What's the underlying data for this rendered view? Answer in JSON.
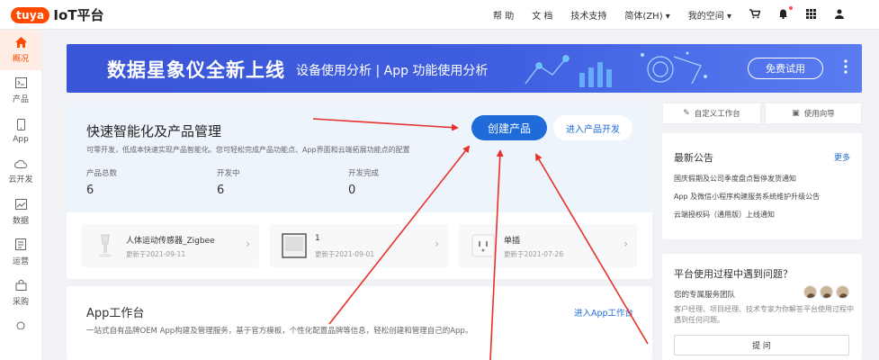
{
  "header": {
    "logo_badge": "tuya",
    "logo_text": "IoT平台",
    "nav": [
      "帮 助",
      "文 档",
      "技术支持",
      "简体(ZH) ▾",
      "我的空间 ▾"
    ],
    "icons": [
      "cart-icon",
      "bell-icon",
      "apps-grid-icon",
      "user-icon"
    ]
  },
  "sidebar": {
    "items": [
      {
        "label": "概况",
        "icon": "home-icon",
        "active": true
      },
      {
        "label": "产品",
        "icon": "terminal-icon"
      },
      {
        "label": "App",
        "icon": "phone-icon"
      },
      {
        "label": "云开发",
        "icon": "cloud-icon"
      },
      {
        "label": "数据",
        "icon": "chart-icon"
      },
      {
        "label": "运营",
        "icon": "operations-icon"
      },
      {
        "label": "采购",
        "icon": "shop-icon"
      }
    ]
  },
  "banner": {
    "title": "数据星象仪全新上线",
    "subtitle": "设备使用分析 | App 功能使用分析",
    "button": "免费试用",
    "more": "⋮"
  },
  "quick": {
    "title": "快速智能化及产品管理",
    "desc": "可零开发，低成本快速实现产品智能化。您可轻松完成产品功能点、App界面和云端拓展功能点的配置",
    "create_button": "创建产品",
    "dev_button": "进入产品开发",
    "stats": [
      {
        "label": "产品总数",
        "value": "6"
      },
      {
        "label": "开发中",
        "value": "6"
      },
      {
        "label": "开发完成",
        "value": "0"
      }
    ],
    "products": [
      {
        "name": "人体运动传感器_Zigbee",
        "date": "更新于2021-09-11"
      },
      {
        "name": "1",
        "date": "更新于2021-09-01"
      },
      {
        "name": "单插",
        "date": "更新于2021-07-26"
      }
    ]
  },
  "app": {
    "title": "App工作台",
    "link": "进入App工作台",
    "desc": "一站式自有品牌OEM App构建及管理服务，基于官方模板，个性化配置品牌等信息，轻松创建和管理自己的App。"
  },
  "right": {
    "custom_workbench": "自定义工作台",
    "guide": "使用向导",
    "notice_title": "最新公告",
    "notice_more": "更多",
    "notices": [
      "国庆假期及公司季度盘点暂停发货通知",
      "App 及微信小程序构建服务系统维护升级公告",
      "云端授权码（通用版）上线通知"
    ],
    "help_title": "平台使用过程中遇到问题？",
    "help_team": "您的专属服务团队",
    "help_desc": "客户经理、项目经理、技术专家为你解答平台使用过程中遇到任何问题。",
    "ask_button": "提 问"
  },
  "colors": {
    "brand": "#ff4800",
    "primary": "#1f6bd9",
    "banner": "#3f5fe0",
    "arrow": "#e8302a"
  }
}
